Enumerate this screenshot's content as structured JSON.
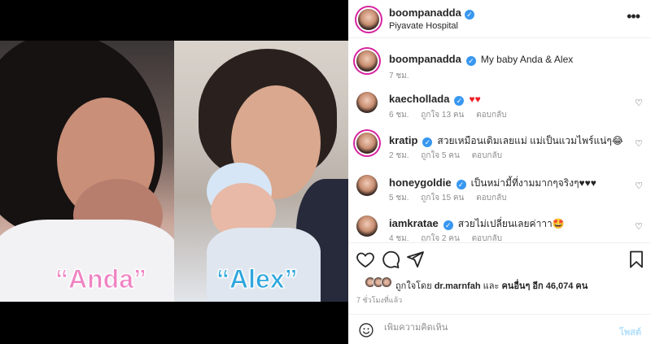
{
  "post": {
    "username": "boompanadda",
    "location": "Piyavate Hospital",
    "caption": "My baby Anda & Alex",
    "caption_time": "7 ชม.",
    "photo_labels": {
      "left": "“Anda”",
      "right": "“Alex”"
    }
  },
  "comments": [
    {
      "username": "kaechollada",
      "text": "♥♥",
      "time": "6 ชม.",
      "likes": "ถูกใจ 13 คน",
      "reply": "ตอบกลับ"
    },
    {
      "username": "kratip",
      "text": "สวยเหมือนเดิมเลยแม่ แม่เป็นแวมไพร์แน่ๆ😂",
      "time": "2 ชม.",
      "likes": "ถูกใจ 5 คน",
      "reply": "ตอบกลับ"
    },
    {
      "username": "honeygoldie",
      "text": "เป็นหม่ามี้ที่งามมากๆจริงๆ♥♥♥",
      "time": "5 ชม.",
      "likes": "ถูกใจ 15 คน",
      "reply": "ตอบกลับ"
    },
    {
      "username": "iamkratae",
      "text": "สวยไม่เปลี่ยนเลยค่าาา🤩",
      "time": "4 ชม.",
      "likes": "ถูกใจ 2 คน",
      "reply": "ตอบกลับ"
    }
  ],
  "likes_line": {
    "prefix": "ถูกใจโดย",
    "user": "dr.marnfah",
    "middle": "และ",
    "others": "คนอื่นๆ อีก 46,074 คน"
  },
  "timestamp": "7 ชั่วโมงที่แล้ว",
  "add_comment": {
    "placeholder": "เพิ่มความคิดเห็น",
    "post_label": "โพสต์"
  },
  "icons": {
    "more": "more-horizontal-icon",
    "like": "heart-icon",
    "comment": "comment-icon",
    "share": "send-icon",
    "save": "bookmark-icon",
    "emoji": "emoji-icon",
    "verified": "verified-badge-icon"
  },
  "colors": {
    "accent": "#3897f0",
    "heart_red": "#ed1c24",
    "anda": "#ef84c3",
    "alex": "#2ea6dd"
  }
}
